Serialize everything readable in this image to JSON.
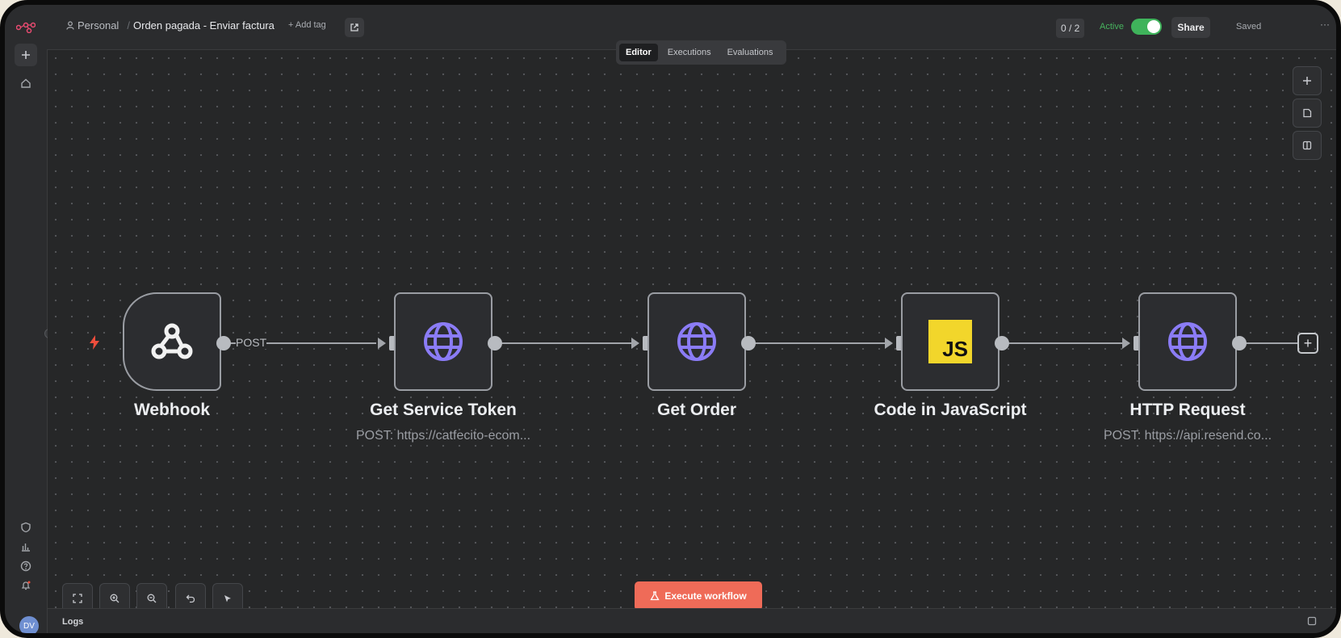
{
  "breadcrumb": {
    "workspace": "Personal"
  },
  "workflow": {
    "title": "Orden pagada - Enviar factura",
    "add_tag": "+ Add tag"
  },
  "header": {
    "version_count": "0 / 2",
    "active_label": "Active",
    "active": true,
    "share_label": "Share",
    "saved_label": "Saved",
    "more_label": "···"
  },
  "tabs": [
    {
      "label": "Editor",
      "selected": true
    },
    {
      "label": "Executions",
      "selected": false
    },
    {
      "label": "Evaluations",
      "selected": false
    }
  ],
  "nodes": [
    {
      "label": "Webhook",
      "subtitle": "",
      "icon": "webhook-icon"
    },
    {
      "label": "Get Service Token",
      "subtitle": "POST: https://catfecito-ecom...",
      "icon": "globe-icon"
    },
    {
      "label": "Get Order",
      "subtitle": "",
      "icon": "globe-icon"
    },
    {
      "label": "Code in JavaScript",
      "subtitle": "",
      "icon": "js-icon",
      "icon_text": "JS"
    },
    {
      "label": "HTTP Request",
      "subtitle": "POST: https://api.resend.co...",
      "icon": "globe-icon"
    }
  ],
  "edges": {
    "webhook_method_label": "POST"
  },
  "canvas_controls": {
    "add_plus": "+"
  },
  "execute": {
    "label": "Execute workflow"
  },
  "logs": {
    "label": "Logs"
  },
  "user": {
    "initials": "DV"
  },
  "colors": {
    "accent": "#ef6b58",
    "active": "#3fb35b",
    "globe": "#8b7cf6",
    "js": "#f2d62b",
    "trigger": "#ef4d3c"
  }
}
